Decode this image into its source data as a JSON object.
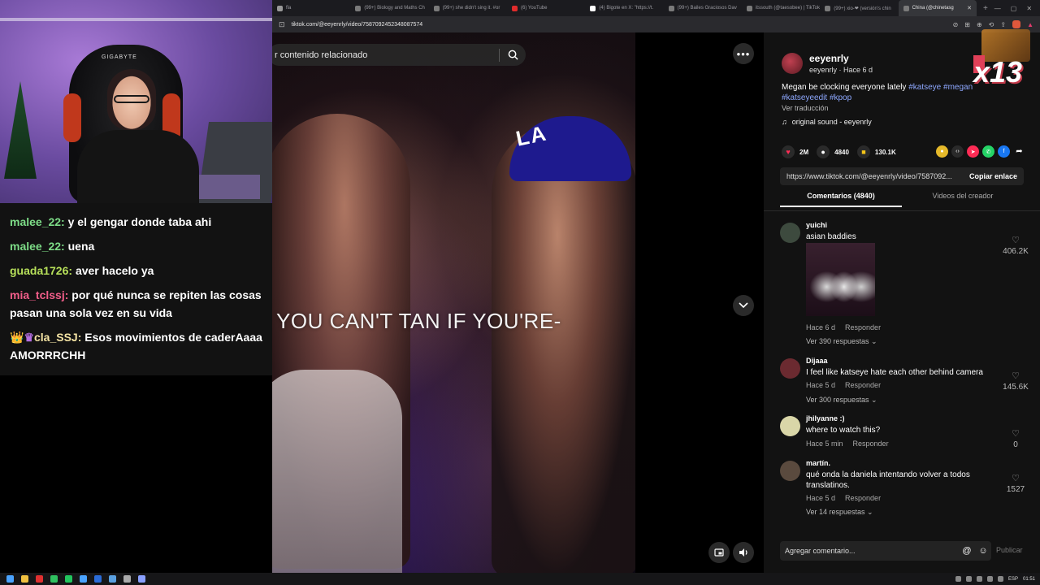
{
  "browser": {
    "tabs": [
      {
        "title": "fla",
        "color": "#999999"
      },
      {
        "title": "(99+) Biology and Maths Ch",
        "color": "#7a7a7a"
      },
      {
        "title": "(99+) she didn't sing it. #or",
        "color": "#7a7a7a"
      },
      {
        "title": "(6) YouTube",
        "color": "#e02b2b"
      },
      {
        "title": "(4) Bigote en X: \"https://t.",
        "color": "#ffffff"
      },
      {
        "title": "(99+) Bailes Graciosos Dav",
        "color": "#7a7a7a"
      },
      {
        "title": "itssouth (@taesobee) | TikTok",
        "color": "#7a7a7a"
      },
      {
        "title": "(99+) xio-❤ (versión's chin",
        "color": "#7a7a7a"
      },
      {
        "title": "China (@chinetasg",
        "color": "#7a7a7a",
        "active": true
      }
    ],
    "tab_close": "✕",
    "new_tab": "+",
    "window_controls": [
      "—",
      "▢",
      "✕"
    ],
    "url": "tiktok.com/@eeyenrly/video/7587092452348087574"
  },
  "video": {
    "search_placeholder": "r contenido relacionado",
    "subtitle": "YOU CAN'T TAN IF YOU'RE-",
    "cap_logo": "LA",
    "more_icon": "•••",
    "down_icon": "⌄",
    "pip_icon": "▣",
    "volume_icon": "🔊"
  },
  "post": {
    "author": "eeyenrly",
    "author_meta": "eeyenrly · Hace 6 d",
    "desc_text": "Megan be clocking everyone lately ",
    "hashtags": [
      "#katseye",
      "#megan",
      "#katseyeedit",
      "#kpop"
    ],
    "translate": "Ver traducción",
    "sound_icon": "♫",
    "sound": "original sound - eeyenrly",
    "likes": "2M",
    "comments": "4840",
    "saves": "130.1K",
    "link": "https://www.tiktok.com/@eeyenrly/video/7587092...",
    "copy_link": "Copiar enlace",
    "tab_comments": "Comentarios (4840)",
    "tab_creator": "Videos del creador",
    "overlay": "x13"
  },
  "comments": [
    {
      "user": "yuichi",
      "text": "asian baddies",
      "time": "Hace 6 d",
      "reply": "Responder",
      "replies": "Ver 390 respuestas ⌄",
      "likes": "406.2K",
      "avatar_color": "#3d4a3e"
    },
    {
      "user": "Dijaaa",
      "text": "I feel like katseye hate each other behind camera",
      "time": "Hace 5 d",
      "reply": "Responder",
      "replies": "Ver 300 respuestas ⌄",
      "likes": "145.6K",
      "avatar_color": "#6b2a30"
    },
    {
      "user": "jhilyanne :)",
      "text": "where to watch this?",
      "time": "Hace 5 min",
      "reply": "Responder",
      "replies": "",
      "likes": "0",
      "avatar_color": "#d9d6a8"
    },
    {
      "user": "martín.",
      "text": "qué onda la daniela intentando volver a todos translatinos.",
      "time": "Hace 5 d",
      "reply": "Responder",
      "replies": "Ver 14 respuestas ⌄",
      "likes": "1527",
      "avatar_color": "#5a4a3e"
    }
  ],
  "comment_input": {
    "placeholder": "Agregar comentario...",
    "mention_icon": "@",
    "emoji_icon": "☺",
    "publish": "Publicar"
  },
  "stream": {
    "chair_brand": "GIGABYTE",
    "chat": [
      {
        "user": "malee_22:",
        "msg": "y el gengar donde taba ahi",
        "cls": "u1"
      },
      {
        "user": "malee_22:",
        "msg": "uena",
        "cls": "u2"
      },
      {
        "user": "guada1726:",
        "msg": "aver hacelo ya",
        "cls": "u3"
      },
      {
        "user": "mia_tclssj:",
        "msg": "por qué nunca se repiten las cosas pasan una sola vez en su vida",
        "cls": "u4"
      },
      {
        "user": "cla_SSJ:",
        "msg": "Esos movimientos de caderAaaa AMORRRCHH",
        "cls": "u5",
        "badges": [
          "👑",
          "♛"
        ]
      }
    ]
  },
  "taskbar": {
    "icons": [
      "#4aa3ff",
      "#f0c040",
      "#e03030",
      "#30c060",
      "#22c55e",
      "#4aa3ff",
      "#2b6cd8",
      "#5aa0e0",
      "#aaaaaa",
      "#8aa0ff"
    ],
    "lang": "ESP",
    "time": "01:51"
  },
  "colors": {
    "accent": "#fe2c55",
    "hashtag": "#8ea8ff",
    "sidebar_bg": "#121212"
  }
}
